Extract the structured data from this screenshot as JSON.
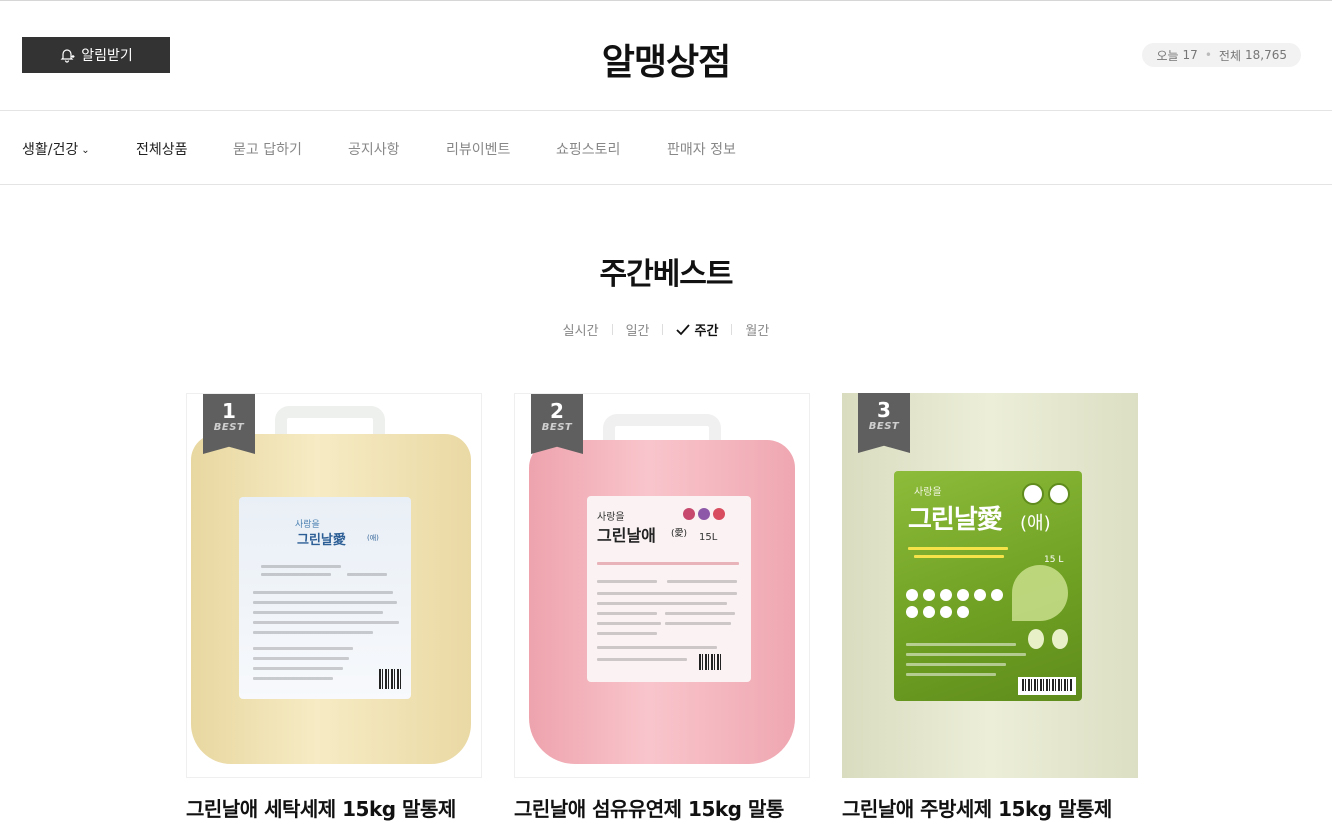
{
  "header": {
    "notify_label": "알림받기",
    "store_title": "알맹상점",
    "visitors": {
      "today_label": "오늘",
      "today_count": "17",
      "total_label": "전체",
      "total_count": "18,765"
    }
  },
  "nav": {
    "category": "생활/건강",
    "items": [
      "전체상품",
      "묻고 답하기",
      "공지사항",
      "리뷰이벤트",
      "쇼핑스토리",
      "판매자 정보"
    ]
  },
  "section": {
    "title": "주간베스트",
    "tabs": [
      "실시간",
      "일간",
      "주간",
      "월간"
    ],
    "active_tab": "주간"
  },
  "products": [
    {
      "rank": "1",
      "badge": "BEST",
      "name": "그린날애 세탁세제 15kg 말통제",
      "label_brand": "사랑을",
      "label_title": "그린날愛",
      "label_sub": "(애)",
      "color": "#efe3b6"
    },
    {
      "rank": "2",
      "badge": "BEST",
      "name": "그린날애 섬유유연제 15kg 말통",
      "label_brand": "사랑을",
      "label_title": "그린날애",
      "label_sub": "(愛)",
      "volume": "15L",
      "color": "#f3b6be"
    },
    {
      "rank": "3",
      "badge": "BEST",
      "name": "그린날애 주방세제 15kg 말통제",
      "label_brand": "사랑을",
      "label_title": "그린날愛",
      "label_sub": "(애)",
      "volume": "15 L",
      "color": "#e2e4cc"
    }
  ],
  "colors": {
    "dark_button": "#333333",
    "badge": "#5f5f5f",
    "muted_text": "#888888"
  }
}
